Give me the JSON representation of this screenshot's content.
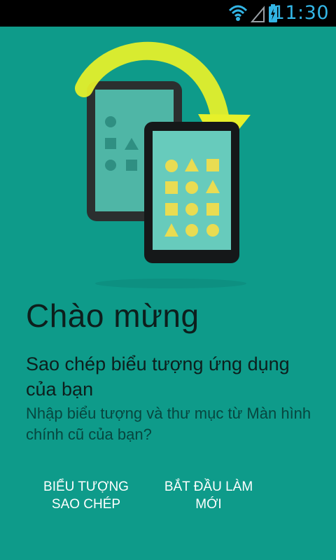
{
  "status_bar": {
    "time": "11:30",
    "icons": [
      "wifi-icon",
      "cell-signal-icon",
      "battery-charging-icon"
    ]
  },
  "hero": {
    "illustration": "phone-migration-illustration",
    "colors": {
      "arrow": "#e6f02a",
      "device_body": "#2b2f2f",
      "old_screen": "#4fb6a6",
      "new_screen": "#67cbbc",
      "shape_fill": "#e9dc52"
    }
  },
  "welcome": {
    "title": "Chào mừng",
    "subtitle": "Sao chép biểu tượng ứng dụng của bạn",
    "description": "Nhập biểu tượng và thư mục từ Màn hình chính cũ của bạn?"
  },
  "actions": {
    "copy_label": "BIỂU TƯỢNG\nSAO CHÉP",
    "fresh_label": "BẮT ĐẦU LÀM\nMỚI"
  },
  "colors": {
    "background": "#0e9b8a",
    "status_bar": "#000000",
    "status_accent": "#33b5e5",
    "text_dark": "#0d1f1d",
    "button_text": "#ffffff"
  }
}
